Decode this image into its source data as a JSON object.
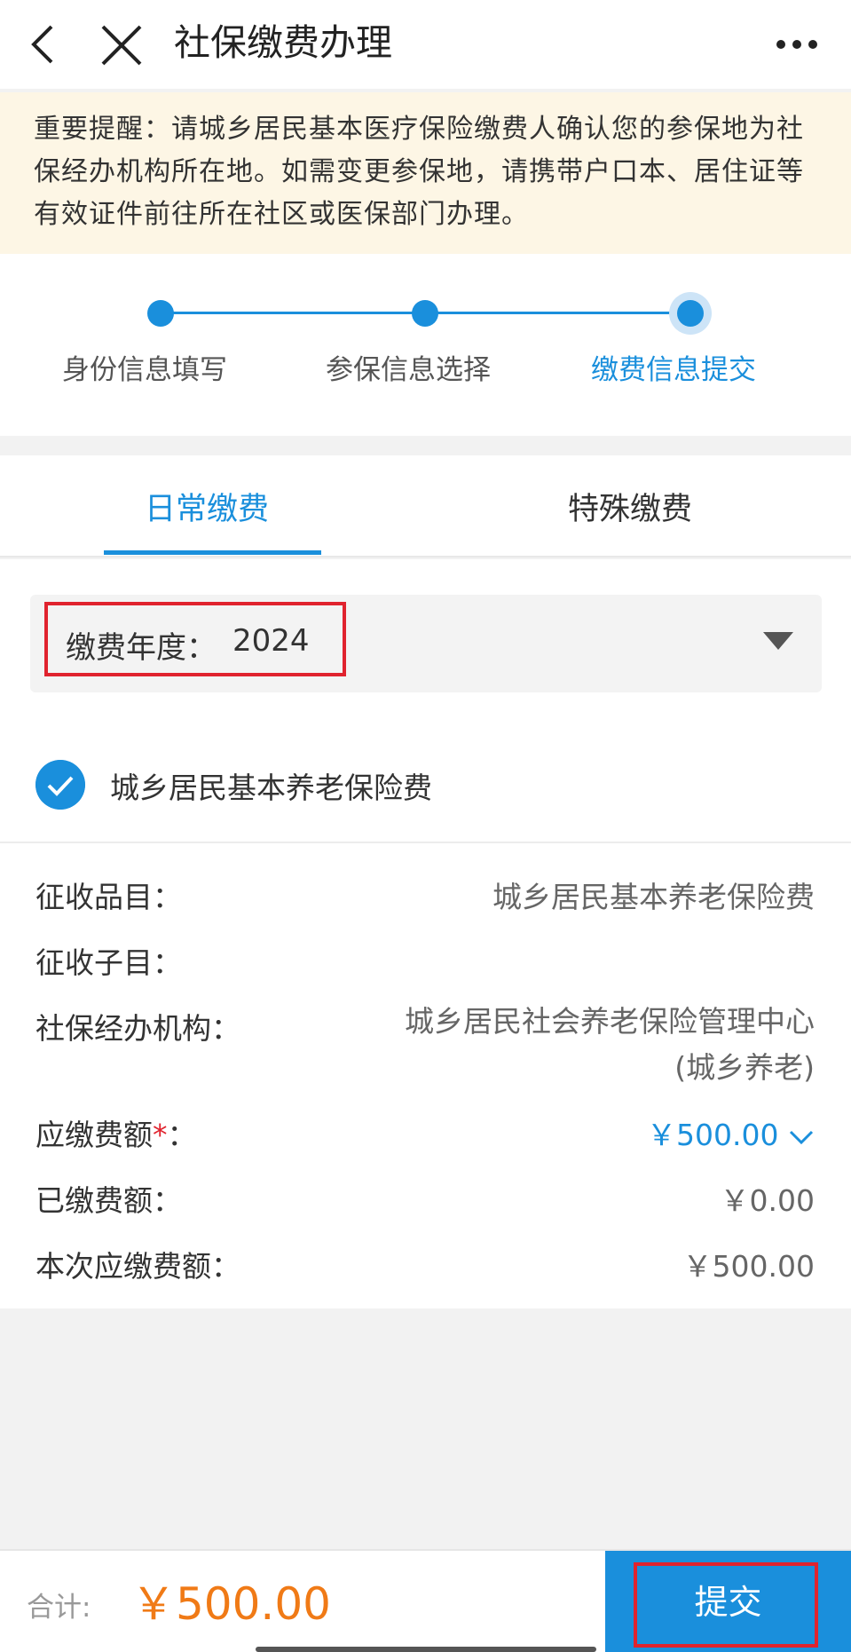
{
  "header": {
    "title": "社保缴费办理"
  },
  "notice": {
    "text": "重要提醒：请城乡居民基本医疗保险缴费人确认您的参保地为社保经办机构所在地。如需变更参保地，请携带户口本、居住证等有效证件前往所在社区或医保部门办理。"
  },
  "steps": [
    {
      "label": "身份信息填写"
    },
    {
      "label": "参保信息选择"
    },
    {
      "label": "缴费信息提交"
    }
  ],
  "tabs": [
    {
      "label": "日常缴费"
    },
    {
      "label": "特殊缴费"
    }
  ],
  "year_select": {
    "label": "缴费年度：",
    "value": "2024"
  },
  "item": {
    "name": "城乡居民基本养老保险费",
    "checked": true
  },
  "rows": {
    "category_label": "征收品目：",
    "category_value": "城乡居民基本养老保险费",
    "subcategory_label": "征收子目：",
    "subcategory_value": "",
    "agency_label": "社保经办机构：",
    "agency_value": "城乡居民社会养老保险管理中心(城乡养老)",
    "payable_label": "应缴费额",
    "payable_required": "*",
    "payable_colon": "：",
    "payable_value": "￥500.00",
    "paid_label": "已缴费额：",
    "paid_value": "￥0.00",
    "current_label": "本次应缴费额：",
    "current_value": "￥500.00"
  },
  "footer": {
    "total_label": "合计:",
    "total_value": "￥500.00",
    "submit_label": "提交"
  },
  "colors": {
    "accent": "#1a8fdc",
    "total": "#f07a16",
    "highlight": "#e0232e",
    "notice_bg": "#fdf6e5"
  }
}
